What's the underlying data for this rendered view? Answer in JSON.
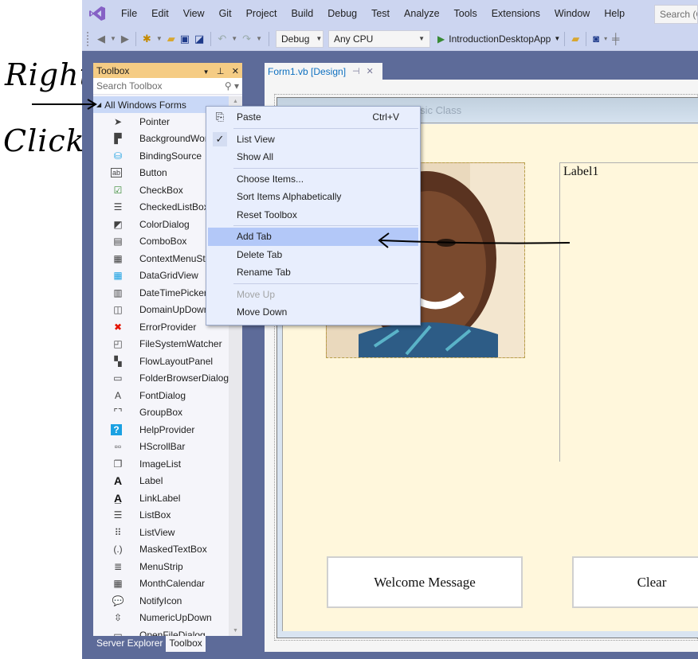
{
  "annotation": {
    "line1": "Right",
    "line2": "Click"
  },
  "menubar": {
    "items": [
      "File",
      "Edit",
      "View",
      "Git",
      "Project",
      "Build",
      "Debug",
      "Test",
      "Analyze",
      "Tools",
      "Extensions",
      "Window",
      "Help"
    ],
    "search_placeholder": "Search (C"
  },
  "toolbar": {
    "config": "Debug",
    "platform": "Any CPU",
    "startup_project": "IntroductionDesktopApp"
  },
  "toolbox": {
    "title": "Toolbox",
    "search_placeholder": "Search Toolbox",
    "group": "All Windows Forms",
    "items": [
      {
        "label": "Pointer",
        "icon": "pointer-icon",
        "glyph": "➤"
      },
      {
        "label": "BackgroundWorker",
        "icon": "background-worker-icon",
        "glyph": "▛"
      },
      {
        "label": "BindingSource",
        "icon": "binding-source-icon",
        "glyph": "⛁"
      },
      {
        "label": "Button",
        "icon": "button-icon",
        "glyph": "ab"
      },
      {
        "label": "CheckBox",
        "icon": "checkbox-icon",
        "glyph": "☑"
      },
      {
        "label": "CheckedListBox",
        "icon": "checked-list-box-icon",
        "glyph": "☰"
      },
      {
        "label": "ColorDialog",
        "icon": "color-dialog-icon",
        "glyph": "◩"
      },
      {
        "label": "ComboBox",
        "icon": "combobox-icon",
        "glyph": "▤"
      },
      {
        "label": "ContextMenuStrip",
        "icon": "context-menu-strip-icon",
        "glyph": "▦"
      },
      {
        "label": "DataGridView",
        "icon": "data-grid-view-icon",
        "glyph": "▦"
      },
      {
        "label": "DateTimePicker",
        "icon": "date-time-picker-icon",
        "glyph": "▥"
      },
      {
        "label": "DomainUpDown",
        "icon": "domain-up-down-icon",
        "glyph": "◫"
      },
      {
        "label": "ErrorProvider",
        "icon": "error-provider-icon",
        "glyph": "✖"
      },
      {
        "label": "FileSystemWatcher",
        "icon": "file-system-watcher-icon",
        "glyph": "◰"
      },
      {
        "label": "FlowLayoutPanel",
        "icon": "flow-layout-panel-icon",
        "glyph": "▚"
      },
      {
        "label": "FolderBrowserDialog",
        "icon": "folder-browser-dialog-icon",
        "glyph": "▭"
      },
      {
        "label": "FontDialog",
        "icon": "font-dialog-icon",
        "glyph": "A"
      },
      {
        "label": "GroupBox",
        "icon": "group-box-icon",
        "glyph": "⌜⌝"
      },
      {
        "label": "HelpProvider",
        "icon": "help-provider-icon",
        "glyph": "?"
      },
      {
        "label": "HScrollBar",
        "icon": "hscrollbar-icon",
        "glyph": "▫▫"
      },
      {
        "label": "ImageList",
        "icon": "image-list-icon",
        "glyph": "❐"
      },
      {
        "label": "Label",
        "icon": "label-icon",
        "glyph": "A"
      },
      {
        "label": "LinkLabel",
        "icon": "link-label-icon",
        "glyph": "A̲"
      },
      {
        "label": "ListBox",
        "icon": "list-box-icon",
        "glyph": "☰"
      },
      {
        "label": "ListView",
        "icon": "list-view-icon",
        "glyph": "⠿"
      },
      {
        "label": "MaskedTextBox",
        "icon": "masked-text-box-icon",
        "glyph": "(.)"
      },
      {
        "label": "MenuStrip",
        "icon": "menu-strip-icon",
        "glyph": "≣"
      },
      {
        "label": "MonthCalendar",
        "icon": "month-calendar-icon",
        "glyph": "▦"
      },
      {
        "label": "NotifyIcon",
        "icon": "notify-icon-icon",
        "glyph": "💬"
      },
      {
        "label": "NumericUpDown",
        "icon": "numeric-up-down-icon",
        "glyph": "⇳"
      },
      {
        "label": "OpenFileDialog",
        "icon": "open-file-dialog-icon",
        "glyph": "▭"
      }
    ],
    "bottom_tabs": [
      {
        "label": "Server Explorer",
        "active": false
      },
      {
        "label": "Toolbox",
        "active": true
      }
    ]
  },
  "document": {
    "tab_label": "Form1.vb [Design]",
    "form_title": "Welcome to our Visual Basic Class",
    "label1_text": "Label1",
    "buttons": [
      "Welcome Message",
      "Clear"
    ]
  },
  "context_menu": {
    "items": [
      {
        "label": "Paste",
        "shortcut": "Ctrl+V",
        "icon": "paste-icon",
        "state": "normal"
      },
      {
        "sep": true
      },
      {
        "label": "List View",
        "icon": "check-icon",
        "state": "checked"
      },
      {
        "label": "Show All",
        "state": "normal"
      },
      {
        "sep": true
      },
      {
        "label": "Choose Items...",
        "state": "normal"
      },
      {
        "label": "Sort Items Alphabetically",
        "state": "normal"
      },
      {
        "label": "Reset Toolbox",
        "state": "normal"
      },
      {
        "sep": true
      },
      {
        "label": "Add Tab",
        "state": "highlighted"
      },
      {
        "label": "Delete Tab",
        "state": "normal"
      },
      {
        "label": "Rename Tab",
        "state": "normal"
      },
      {
        "sep": true
      },
      {
        "label": "Move Up",
        "state": "disabled"
      },
      {
        "label": "Move Down",
        "state": "normal"
      }
    ]
  },
  "colors": {
    "accent_toolbox_header": "#f5cc84",
    "menu_highlight": "#b3c8f8",
    "ide_frame": "#5d6b99",
    "form_background": "#fff7dc"
  }
}
